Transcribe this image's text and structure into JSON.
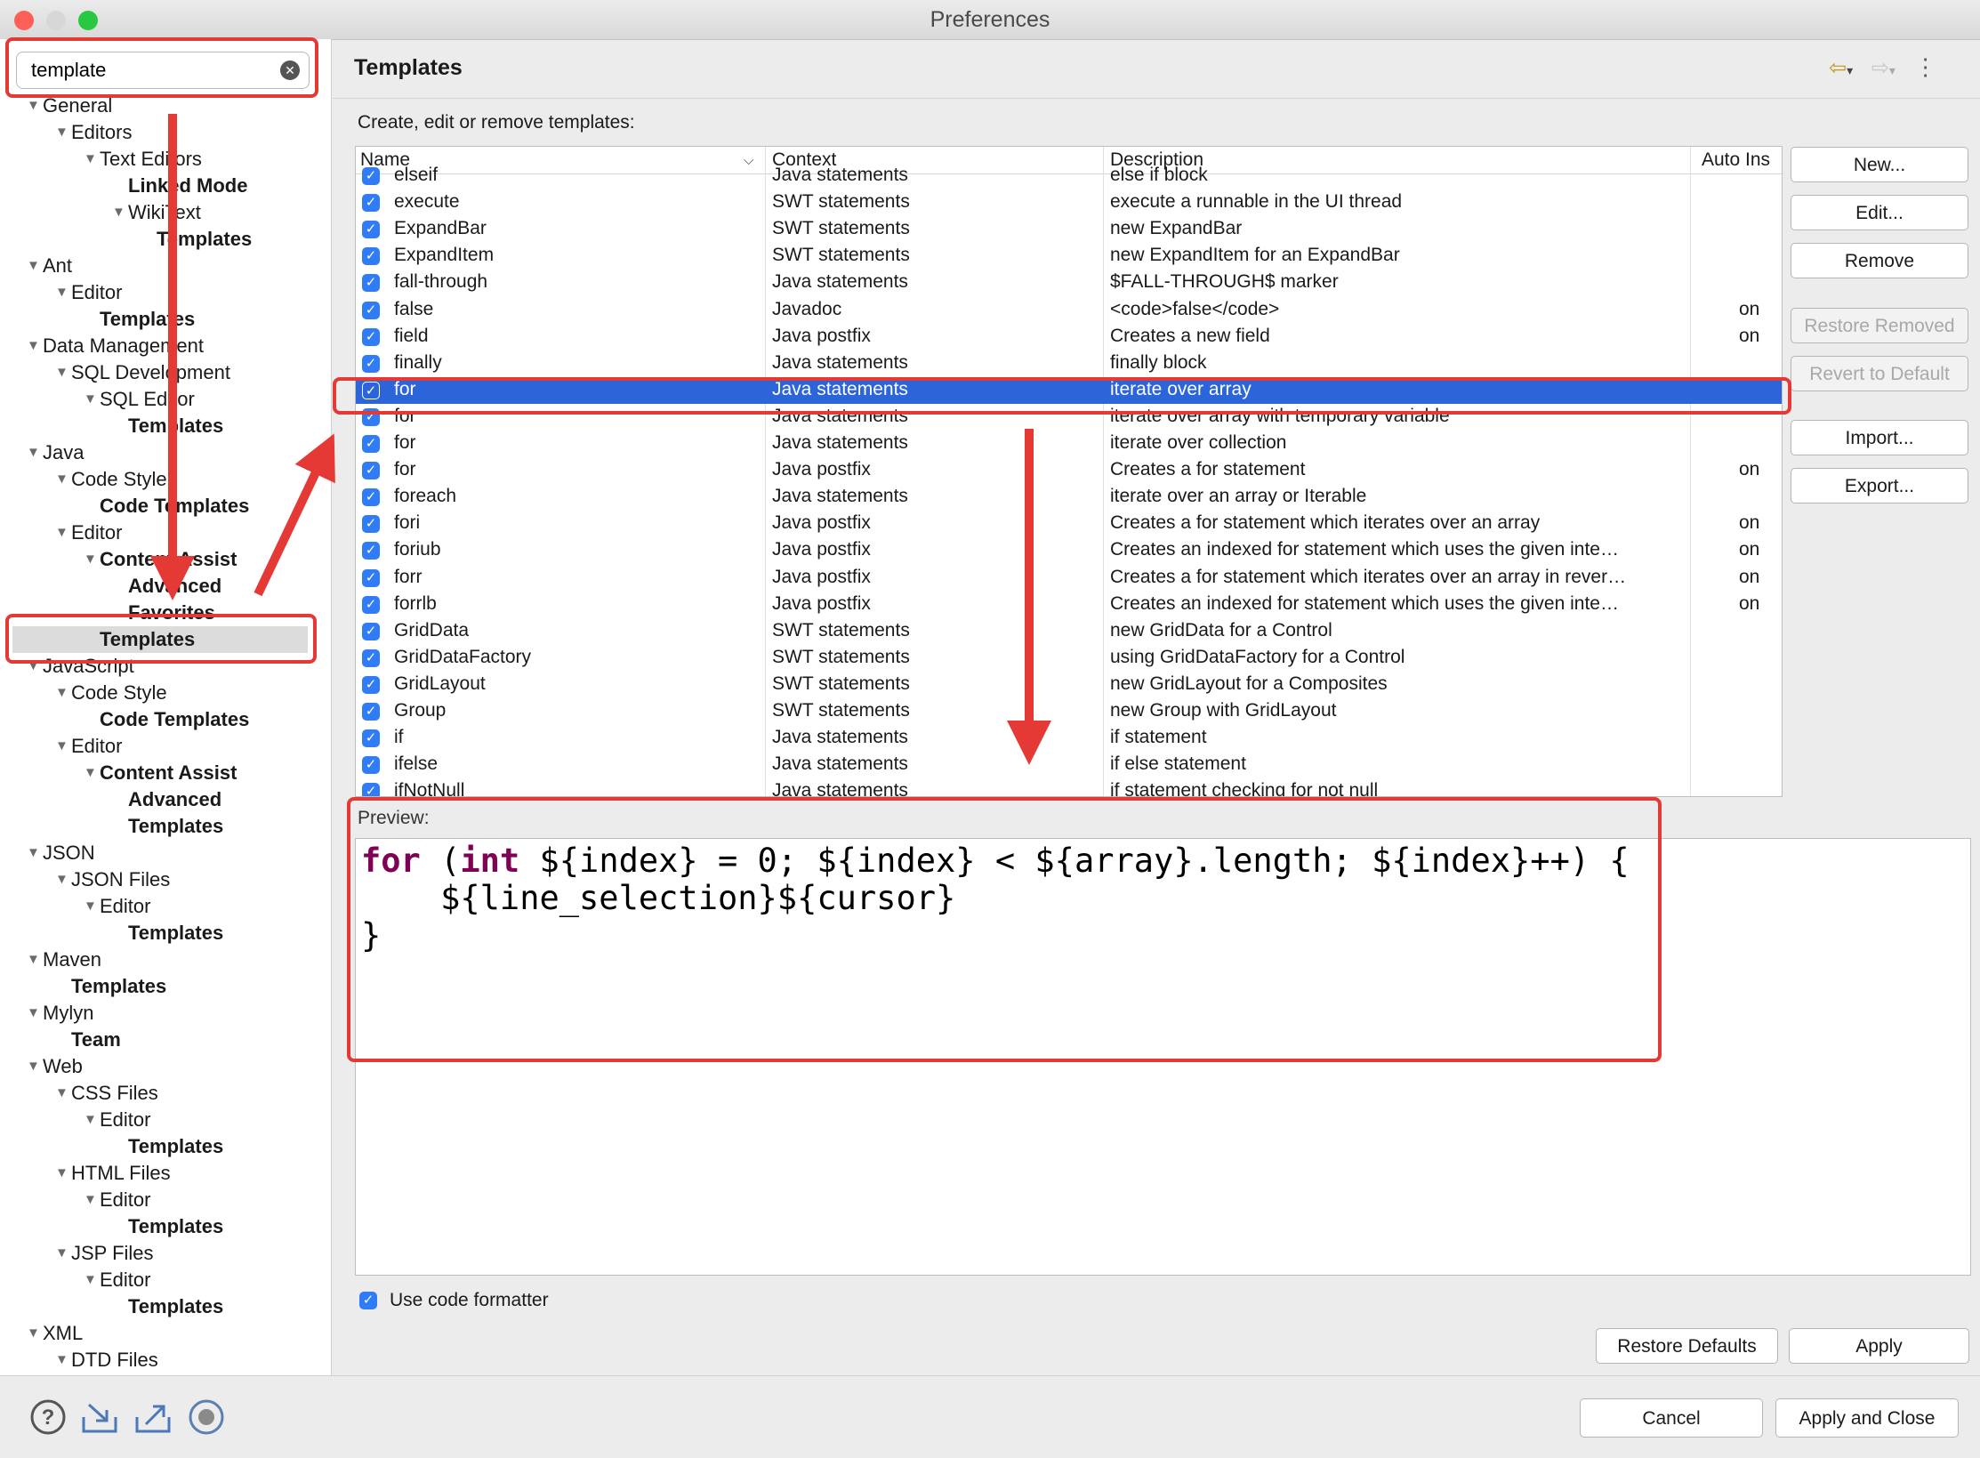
{
  "window": {
    "title": "Preferences"
  },
  "sidebar": {
    "filter_value": "template",
    "tree": [
      {
        "label": "General",
        "level": 0,
        "expanded": true,
        "bold": false
      },
      {
        "label": "Editors",
        "level": 1,
        "expanded": true,
        "bold": false
      },
      {
        "label": "Text Editors",
        "level": 2,
        "expanded": true,
        "bold": false
      },
      {
        "label": "Linked Mode",
        "level": 3,
        "expanded": false,
        "bold": true
      },
      {
        "label": "WikiText",
        "level": 3,
        "expanded": true,
        "bold": false
      },
      {
        "label": "Templates",
        "level": 4,
        "expanded": false,
        "bold": true
      },
      {
        "label": "Ant",
        "level": 0,
        "expanded": true,
        "bold": false
      },
      {
        "label": "Editor",
        "level": 1,
        "expanded": true,
        "bold": false
      },
      {
        "label": "Templates",
        "level": 2,
        "expanded": false,
        "bold": true
      },
      {
        "label": "Data Management",
        "level": 0,
        "expanded": true,
        "bold": false
      },
      {
        "label": "SQL Development",
        "level": 1,
        "expanded": true,
        "bold": false
      },
      {
        "label": "SQL Editor",
        "level": 2,
        "expanded": true,
        "bold": false
      },
      {
        "label": "Templates",
        "level": 3,
        "expanded": false,
        "bold": true
      },
      {
        "label": "Java",
        "level": 0,
        "expanded": true,
        "bold": false
      },
      {
        "label": "Code Style",
        "level": 1,
        "expanded": true,
        "bold": false
      },
      {
        "label": "Code Templates",
        "level": 2,
        "expanded": false,
        "bold": true
      },
      {
        "label": "Editor",
        "level": 1,
        "expanded": true,
        "bold": false
      },
      {
        "label": "Content Assist",
        "level": 2,
        "expanded": true,
        "bold": true
      },
      {
        "label": "Advanced",
        "level": 3,
        "expanded": false,
        "bold": true
      },
      {
        "label": "Favorites",
        "level": 3,
        "expanded": false,
        "bold": true
      },
      {
        "label": "Templates",
        "level": 2,
        "expanded": false,
        "bold": true,
        "selected": true
      },
      {
        "label": "JavaScript",
        "level": 0,
        "expanded": true,
        "bold": false
      },
      {
        "label": "Code Style",
        "level": 1,
        "expanded": true,
        "bold": false
      },
      {
        "label": "Code Templates",
        "level": 2,
        "expanded": false,
        "bold": true
      },
      {
        "label": "Editor",
        "level": 1,
        "expanded": true,
        "bold": false
      },
      {
        "label": "Content Assist",
        "level": 2,
        "expanded": true,
        "bold": true
      },
      {
        "label": "Advanced",
        "level": 3,
        "expanded": false,
        "bold": true
      },
      {
        "label": "Templates",
        "level": 3,
        "expanded": false,
        "bold": true
      },
      {
        "label": "JSON",
        "level": 0,
        "expanded": true,
        "bold": false
      },
      {
        "label": "JSON Files",
        "level": 1,
        "expanded": true,
        "bold": false
      },
      {
        "label": "Editor",
        "level": 2,
        "expanded": true,
        "bold": false
      },
      {
        "label": "Templates",
        "level": 3,
        "expanded": false,
        "bold": true
      },
      {
        "label": "Maven",
        "level": 0,
        "expanded": true,
        "bold": false
      },
      {
        "label": "Templates",
        "level": 1,
        "expanded": false,
        "bold": true
      },
      {
        "label": "Mylyn",
        "level": 0,
        "expanded": true,
        "bold": false
      },
      {
        "label": "Team",
        "level": 1,
        "expanded": false,
        "bold": true
      },
      {
        "label": "Web",
        "level": 0,
        "expanded": true,
        "bold": false
      },
      {
        "label": "CSS Files",
        "level": 1,
        "expanded": true,
        "bold": false
      },
      {
        "label": "Editor",
        "level": 2,
        "expanded": true,
        "bold": false
      },
      {
        "label": "Templates",
        "level": 3,
        "expanded": false,
        "bold": true
      },
      {
        "label": "HTML Files",
        "level": 1,
        "expanded": true,
        "bold": false
      },
      {
        "label": "Editor",
        "level": 2,
        "expanded": true,
        "bold": false
      },
      {
        "label": "Templates",
        "level": 3,
        "expanded": false,
        "bold": true
      },
      {
        "label": "JSP Files",
        "level": 1,
        "expanded": true,
        "bold": false
      },
      {
        "label": "Editor",
        "level": 2,
        "expanded": true,
        "bold": false
      },
      {
        "label": "Templates",
        "level": 3,
        "expanded": false,
        "bold": true
      },
      {
        "label": "XML",
        "level": 0,
        "expanded": true,
        "bold": false
      },
      {
        "label": "DTD Files",
        "level": 1,
        "expanded": true,
        "bold": false
      }
    ]
  },
  "main": {
    "title": "Templates",
    "description": "Create, edit or remove templates:",
    "table": {
      "columns": [
        "Name",
        "Context",
        "Description",
        "Auto Ins"
      ],
      "rows": [
        {
          "name": "elseif",
          "context": "Java statements",
          "description": "else if block",
          "auto": ""
        },
        {
          "name": "execute",
          "context": "SWT statements",
          "description": "execute a runnable in the UI thread",
          "auto": ""
        },
        {
          "name": "ExpandBar",
          "context": "SWT statements",
          "description": "new ExpandBar",
          "auto": ""
        },
        {
          "name": "ExpandItem",
          "context": "SWT statements",
          "description": "new ExpandItem for an ExpandBar",
          "auto": ""
        },
        {
          "name": "fall-through",
          "context": "Java statements",
          "description": "$FALL-THROUGH$ marker",
          "auto": ""
        },
        {
          "name": "false",
          "context": "Javadoc",
          "description": "<code>false</code>",
          "auto": "on"
        },
        {
          "name": "field",
          "context": "Java postfix",
          "description": "Creates a new field",
          "auto": "on"
        },
        {
          "name": "finally",
          "context": "Java statements",
          "description": "finally block",
          "auto": ""
        },
        {
          "name": "for",
          "context": "Java statements",
          "description": "iterate over array",
          "auto": "",
          "selected": true
        },
        {
          "name": "for",
          "context": "Java statements",
          "description": "iterate over array with temporary variable",
          "auto": ""
        },
        {
          "name": "for",
          "context": "Java statements",
          "description": "iterate over collection",
          "auto": ""
        },
        {
          "name": "for",
          "context": "Java postfix",
          "description": "Creates a for statement",
          "auto": "on"
        },
        {
          "name": "foreach",
          "context": "Java statements",
          "description": "iterate over an array or Iterable",
          "auto": ""
        },
        {
          "name": "fori",
          "context": "Java postfix",
          "description": "Creates a for statement which iterates over an array",
          "auto": "on"
        },
        {
          "name": "foriub",
          "context": "Java postfix",
          "description": "Creates an indexed for statement which uses the given inte…",
          "auto": "on"
        },
        {
          "name": "forr",
          "context": "Java postfix",
          "description": "Creates a for statement which iterates over an array in rever…",
          "auto": "on"
        },
        {
          "name": "forrlb",
          "context": "Java postfix",
          "description": "Creates an indexed for statement which uses the given inte…",
          "auto": "on"
        },
        {
          "name": "GridData",
          "context": "SWT statements",
          "description": "new GridData for a Control",
          "auto": ""
        },
        {
          "name": "GridDataFactory",
          "context": "SWT statements",
          "description": "using GridDataFactory for a Control",
          "auto": ""
        },
        {
          "name": "GridLayout",
          "context": "SWT statements",
          "description": "new GridLayout for a Composites",
          "auto": ""
        },
        {
          "name": "Group",
          "context": "SWT statements",
          "description": "new Group with GridLayout",
          "auto": ""
        },
        {
          "name": "if",
          "context": "Java statements",
          "description": "if statement",
          "auto": ""
        },
        {
          "name": "ifelse",
          "context": "Java statements",
          "description": "if else statement",
          "auto": ""
        },
        {
          "name": "ifNotNull",
          "context": "Java statements",
          "description": "if statement checking for not null",
          "auto": ""
        }
      ]
    },
    "buttons": {
      "new": "New...",
      "edit": "Edit...",
      "remove": "Remove",
      "restore_removed": "Restore Removed",
      "revert_default": "Revert to Default",
      "import": "Import...",
      "export": "Export..."
    },
    "preview_label": "Preview:",
    "preview_code": {
      "line1_kw1": "for",
      "line1_a": " (",
      "line1_kw2": "int",
      "line1_b": " ${index} = 0; ${index} < ${array}.length; ${index}++) {",
      "line2": "    ${line_selection}${cursor}",
      "line3": "}"
    },
    "use_formatter_label": "Use code formatter",
    "restore_defaults": "Restore Defaults",
    "apply": "Apply"
  },
  "footer": {
    "cancel": "Cancel",
    "apply_close": "Apply and Close"
  },
  "colors": {
    "selection": "#2b65d9",
    "annotation": "#e53935",
    "checkbox": "#2f7cf6",
    "keyword": "#7f0055"
  }
}
